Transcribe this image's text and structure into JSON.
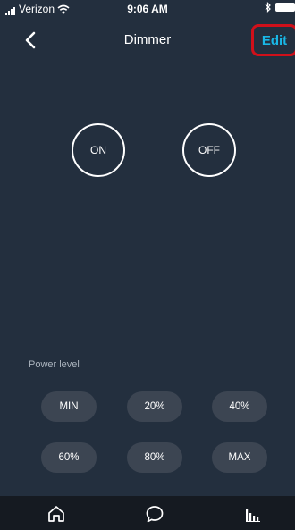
{
  "status": {
    "carrier": "Verizon",
    "time": "9:06 AM",
    "bluetooth": "bluetooth-icon",
    "battery": "battery-icon"
  },
  "header": {
    "title": "Dimmer",
    "edit_label": "Edit"
  },
  "main": {
    "on_label": "ON",
    "off_label": "OFF",
    "power_level_label": "Power level",
    "levels": [
      "MIN",
      "20%",
      "40%",
      "60%",
      "80%",
      "MAX"
    ]
  },
  "tabbar": {
    "items": [
      "home-icon",
      "chat-icon",
      "equalizer-icon"
    ]
  },
  "colors": {
    "background": "#232f3e",
    "accent": "#19b7e6",
    "highlight_box": "#d0101a",
    "pill_bg": "#3c4552",
    "tabbar_bg": "#151a21"
  }
}
